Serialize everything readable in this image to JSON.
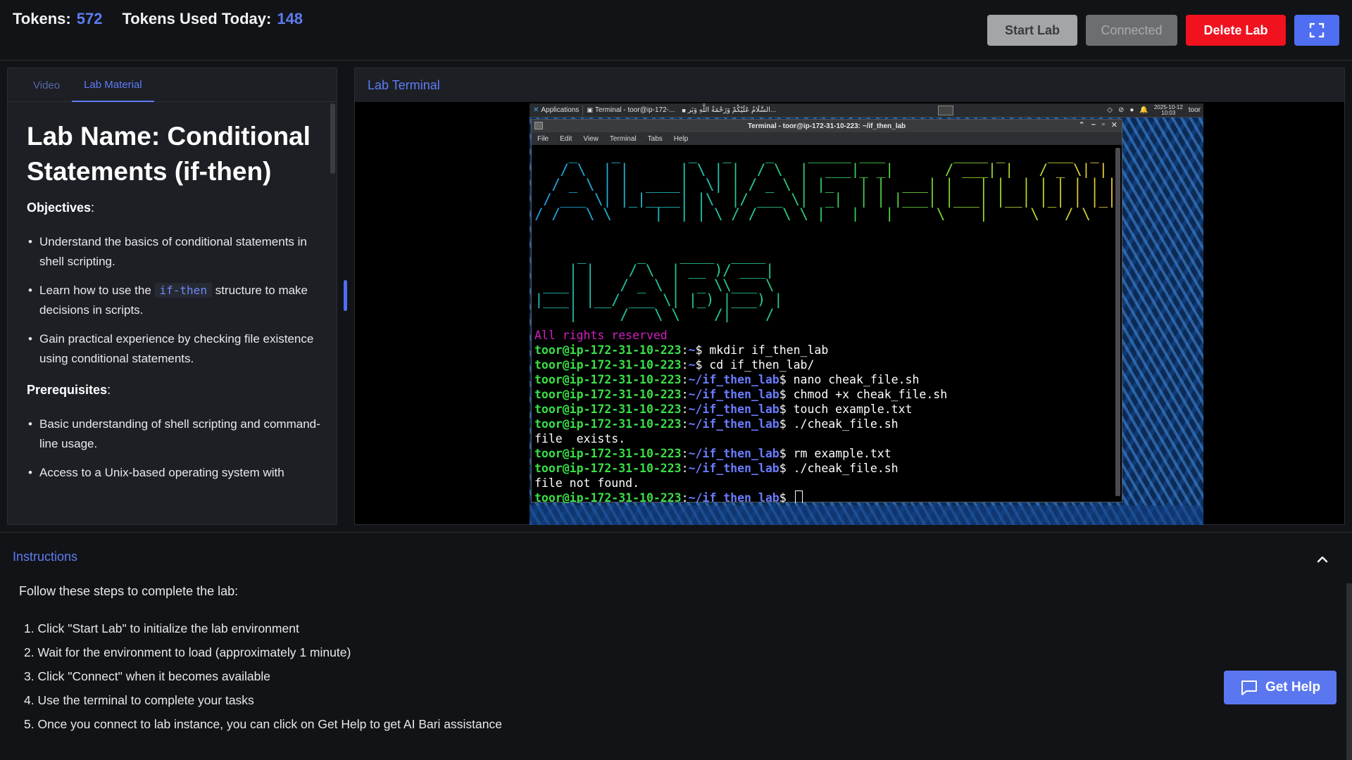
{
  "header": {
    "tokens_label": "Tokens:",
    "tokens_value": "572",
    "used_label": "Tokens Used Today:",
    "used_value": "148",
    "buttons": {
      "start": "Start Lab",
      "connected": "Connected",
      "delete": "Delete Lab",
      "fullscreen_icon": "fullscreen-icon"
    }
  },
  "left_panel": {
    "tabs": [
      {
        "label": "Video",
        "active": false
      },
      {
        "label": "Lab Material",
        "active": true
      }
    ],
    "title": "Lab Name: Conditional Statements (if-then)",
    "objectives_heading": "Objectives",
    "objectives": {
      "item1": "Understand the basics of conditional statements in shell scripting.",
      "item2_pre": "Learn how to use the",
      "item2_code": "if-then",
      "item2_post": "structure to make decisions in scripts.",
      "item3": "Gain practical experience by checking file existence using conditional statements."
    },
    "prerequisites_heading": "Prerequisites",
    "prerequisites": [
      "Basic understanding of shell scripting and command-line usage.",
      "Access to a Unix-based operating system with"
    ]
  },
  "terminal_panel": {
    "title": "Lab Terminal",
    "desktop": {
      "panel_applications": "Applications",
      "panel_task": "Terminal - toor@ip-172-...",
      "panel_arabic": "السَّلَامُ عَلَيْكُمْ وَرَحْمَةُ اللَّهِ وَبَر...",
      "clock_date": "2025-10-12",
      "clock_time": "10:03",
      "panel_user": "toor"
    },
    "window": {
      "title": "Terminal - toor@ip-172-31-10-223: ~/if_then_lab",
      "menu": [
        "File",
        "Edit",
        "View",
        "Terminal",
        "Tabs",
        "Help"
      ]
    },
    "rights": "All rights reserved",
    "session": {
      "user_host": "toor@ip-172-31-10-223",
      "home_path": "~",
      "lab_path": "~/if_then_lab",
      "cmd1": "mkdir if_then_lab",
      "cmd2": "cd if_then_lab/",
      "cmd3": "nano cheak_file.sh",
      "cmd4": "chmod +x cheak_file.sh",
      "cmd5": "touch example.txt",
      "cmd6": "./cheak_file.sh",
      "out1": "file  exists.",
      "cmd7": "rm example.txt",
      "cmd8": "./cheak_file.sh",
      "out2": "file not found."
    }
  },
  "instructions": {
    "title": "Instructions",
    "intro": "Follow these steps to complete the lab:",
    "steps": [
      "1. Click \"Start Lab\" to initialize the lab environment",
      "2. Wait for the environment to load (approximately 1 minute)",
      "3. Click \"Connect\" when it becomes available",
      "4. Use the terminal to complete your tasks",
      "5. Once you connect to lab instance, you can click on Get Help to get AI Bari assistance"
    ]
  },
  "help_button": "Get Help",
  "colors": {
    "accent": "#5f7cf6",
    "delete": "#f0121f",
    "prompt_user": "#39e046",
    "prompt_path": "#6a7cff",
    "rights": "#d21fc0"
  }
}
